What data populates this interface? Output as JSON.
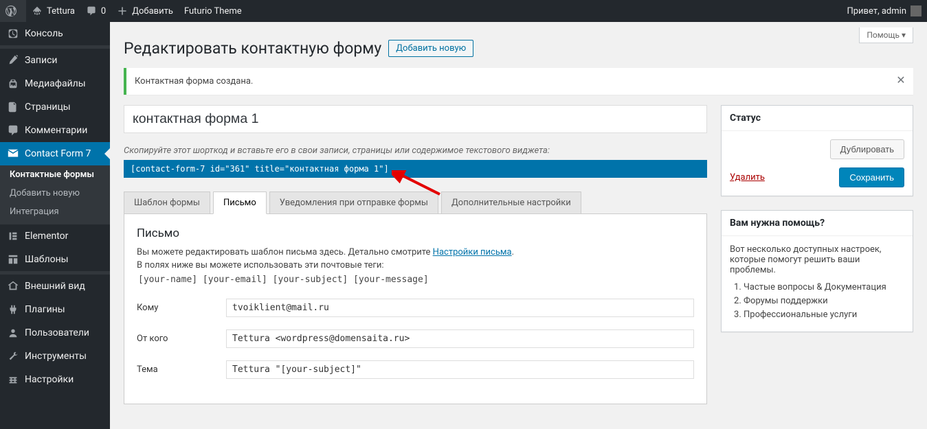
{
  "adminbar": {
    "site": "Tettura",
    "comments": "0",
    "add": "Добавить",
    "theme": "Futurio Theme",
    "greeting": "Привет, admin"
  },
  "help": "Помощь",
  "menu": {
    "dashboard": "Консоль",
    "posts": "Записи",
    "media": "Медиафайлы",
    "pages": "Страницы",
    "comments": "Комментарии",
    "cf7": "Contact Form 7",
    "cf7_forms": "Контактные формы",
    "cf7_add": "Добавить новую",
    "cf7_int": "Интеграция",
    "elementor": "Elementor",
    "templates": "Шаблоны",
    "appearance": "Внешний вид",
    "plugins": "Плагины",
    "users": "Пользователи",
    "tools": "Инструменты",
    "settings": "Настройки"
  },
  "page": {
    "title": "Редактировать контактную форму",
    "add_new": "Добавить новую",
    "notice": "Контактная форма создана.",
    "form_title": "контактная форма 1",
    "shortcode_desc": "Скопируйте этот шорткод и вставьте его в свои записи, страницы или содержимое текстового виджета:",
    "shortcode": "[contact-form-7 id=\"361\" title=\"контактная форма 1\"]"
  },
  "tabs": {
    "form": "Шаблон формы",
    "mail": "Письмо",
    "messages": "Уведомления при отправке формы",
    "additional": "Дополнительные настройки"
  },
  "mail": {
    "heading": "Письмо",
    "desc1_a": "Вы можете редактировать шаблон письма здесь. Детально смотрите ",
    "desc1_link": "Настройки письма",
    "desc2": "В полях ниже вы можете использовать эти почтовые теги:",
    "tags": "[your-name] [your-email] [your-subject] [your-message]",
    "to_label": "Кому",
    "to_value": "tvoiklient@mail.ru",
    "from_label": "От кого",
    "from_value": "Tettura <wordpress@domensaita.ru>",
    "subject_label": "Тема",
    "subject_value": "Tettura \"[your-subject]\""
  },
  "sidebar": {
    "status_h": "Статус",
    "duplicate": "Дублировать",
    "delete": "Удалить",
    "save": "Сохранить",
    "help_h": "Вам нужна помощь?",
    "help_p": "Вот несколько доступных настроек, которые помогут решить ваши проблемы.",
    "faq": "Частые вопросы",
    "and": " & ",
    "docs": "Документация",
    "support": "Форумы поддержки",
    "pro": "Профессиональные услуги"
  }
}
